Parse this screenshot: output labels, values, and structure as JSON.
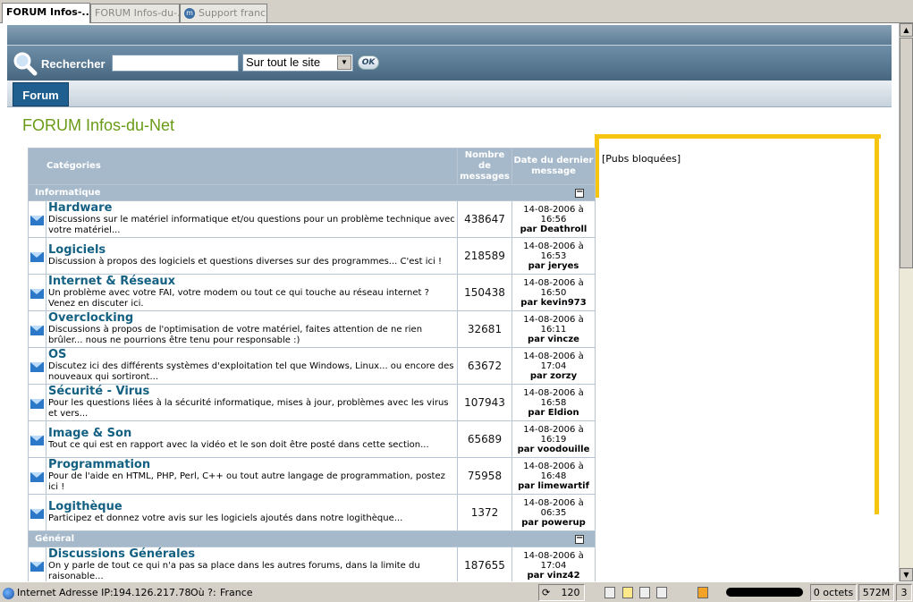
{
  "tabs": [
    {
      "label": "FORUM Infos-..."
    },
    {
      "label": "FORUM Infos-du-..."
    },
    {
      "label": "Support franc..."
    }
  ],
  "search": {
    "label": "Rechercher",
    "value": "",
    "scope": "Sur tout le site",
    "ok": "OK"
  },
  "nav": {
    "forum": "Forum"
  },
  "page": {
    "title": "FORUM Infos-du-Net",
    "ads": "[Pubs bloquées]"
  },
  "table": {
    "headers": {
      "cat": "Catégories",
      "count": "Nombre de messages",
      "date": "Date du dernier message"
    },
    "sections": [
      {
        "name": "Informatique",
        "toggle": "−",
        "forums": [
          {
            "title": "Hardware",
            "desc": "Discussions sur le matériel informatique et/ou questions pour un problème technique avec votre matériel...",
            "count": "438647",
            "date": "14-08-2006 à 16:56",
            "by": "par Deathroll"
          },
          {
            "title": "Logiciels",
            "desc": "Discussion à propos des logiciels et questions diverses sur des programmes... C'est ici !",
            "count": "218589",
            "date": "14-08-2006 à 16:53",
            "by": "par jeryes"
          },
          {
            "title": "Internet & Réseaux",
            "desc": "Un problème avec votre FAI, votre modem ou tout ce qui touche au réseau internet ? Venez en discuter ici.",
            "count": "150438",
            "date": "14-08-2006 à 16:50",
            "by": "par kevin973"
          },
          {
            "title": "Overclocking",
            "desc": "Discussions à propos de l'optimisation de votre matériel, faites attention de ne rien brûler... nous ne pourrions être tenu pour responsable :)",
            "count": "32681",
            "date": "14-08-2006 à 16:11",
            "by": "par vincze"
          },
          {
            "title": "OS",
            "desc": "Discutez ici des différents systèmes d'exploitation tel que Windows, Linux... ou encore des nouveaux qui sortiront...",
            "count": "63672",
            "date": "14-08-2006 à 17:04",
            "by": "par zorzy"
          },
          {
            "title": "Sécurité - Virus",
            "desc": "Pour les questions liées à la sécurité informatique, mises à jour, problèmes avec les virus et vers...",
            "count": "107943",
            "date": "14-08-2006 à 16:58",
            "by": "par Eldion"
          },
          {
            "title": "Image & Son",
            "desc": "Tout ce qui est en rapport avec la vidéo et le son doit être posté dans cette section...",
            "count": "65689",
            "date": "14-08-2006 à 16:19",
            "by": "par voodouille"
          },
          {
            "title": "Programmation",
            "desc": "Pour de l'aide en HTML, PHP, Perl, C++ ou tout autre langage de programmation, postez ici !",
            "count": "75958",
            "date": "14-08-2006 à 16:48",
            "by": "par limewartif"
          },
          {
            "title": "Logithèque",
            "desc": "Participez et donnez votre avis sur les logiciels ajoutés dans notre logithèque...",
            "count": "1372",
            "date": "14-08-2006 à 06:35",
            "by": "par powerup"
          }
        ]
      },
      {
        "name": "Général",
        "toggle": "−",
        "forums": [
          {
            "title": "Discussions Générales",
            "desc": "On y parle de tout ce qui n'a pas sa place dans les autres forums, dans la limite du raisonable...",
            "count": "187655",
            "date": "14-08-2006 à 17:04",
            "by": "par vinz42"
          }
        ]
      }
    ]
  },
  "status": {
    "zone": "Internet",
    "ip_label": "Adresse IP:",
    "ip": "194.126.217.78",
    "where_label": "Où ?:",
    "where": "France",
    "count": "120",
    "bytes": "0 octets",
    "mem": "572M",
    "num": "3"
  },
  "colors": {
    "accent": "#6a9b16",
    "header": "#a6b9ca",
    "link": "#136082",
    "highlight": "#f6c510"
  }
}
